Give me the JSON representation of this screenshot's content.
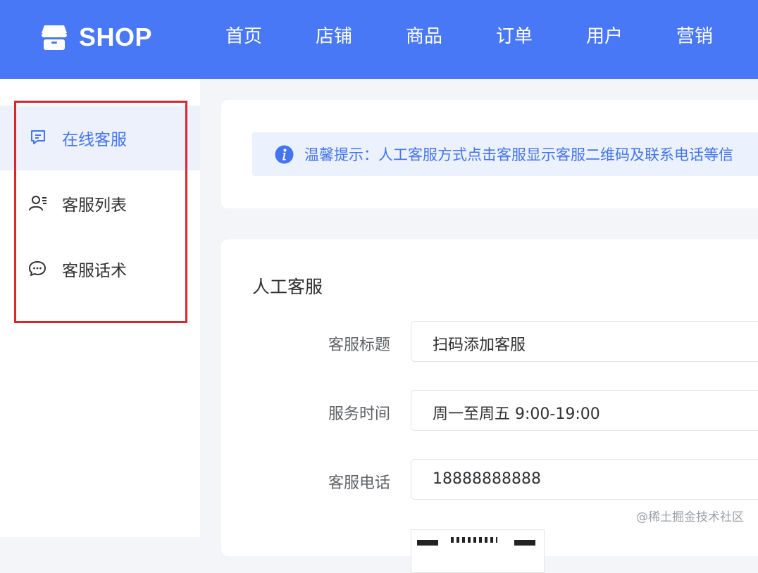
{
  "header": {
    "logo_text": "SHOP",
    "nav": [
      "首页",
      "店铺",
      "商品",
      "订单",
      "用户",
      "营销"
    ],
    "brand_color": "#4878f5"
  },
  "sidebar": {
    "items": [
      {
        "label": "在线客服",
        "icon": "chat-square-icon",
        "active": true
      },
      {
        "label": "客服列表",
        "icon": "user-list-icon",
        "active": false
      },
      {
        "label": "客服话术",
        "icon": "chat-bubbles-icon",
        "active": false
      }
    ],
    "highlight_color": "#d9262c"
  },
  "notice": {
    "icon": "info-icon",
    "text": "温馨提示：人工客服方式点击客服显示客服二维码及联系电话等信"
  },
  "form": {
    "title": "人工客服",
    "fields": [
      {
        "label": "客服标题",
        "value": "扫码添加客服"
      },
      {
        "label": "服务时间",
        "value": "周一至周五 9:00-19:00"
      },
      {
        "label": "客服电话",
        "value": "18888888888"
      }
    ]
  },
  "watermark": "@稀土掘金技术社区"
}
